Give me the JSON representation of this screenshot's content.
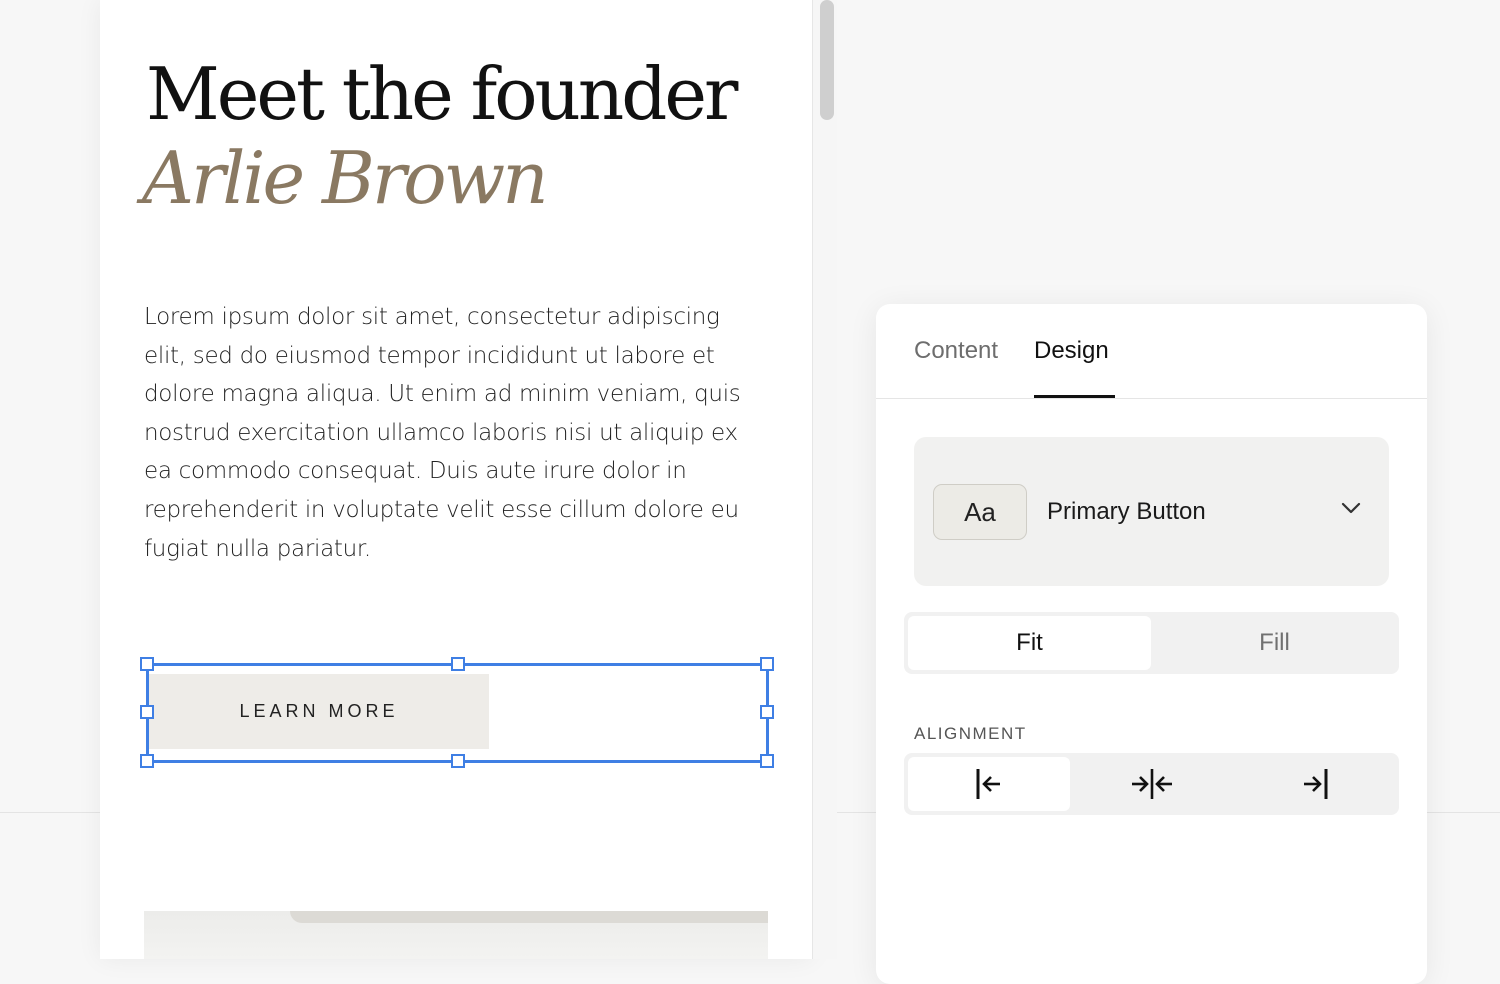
{
  "page": {
    "heading_line1": "Meet the founder",
    "heading_line2": "Arlie Brown",
    "body": "Lorem ipsum dolor sit amet, consectetur adipiscing elit, sed do eiusmod tempor incididunt ut labore et dolore magna aliqua. Ut enim ad minim veniam, quis nostrud exercitation ullamco laboris nisi ut aliquip ex ea commodo consequat. Duis aute irure dolor in reprehenderit in voluptate velit esse cillum dolore eu fugiat nulla pariatur.",
    "button_label": "LEARN MORE"
  },
  "panel": {
    "tabs": [
      {
        "label": "Content",
        "active": false
      },
      {
        "label": "Design",
        "active": true
      }
    ],
    "style_select": {
      "chip_label": "Aa",
      "value": "Primary Button",
      "icon": "chevron-down-icon"
    },
    "width_toggle": {
      "options": [
        "Fit",
        "Fill"
      ],
      "selected": "Fit"
    },
    "alignment": {
      "label": "ALIGNMENT",
      "options": [
        "align-left-icon",
        "align-center-icon",
        "align-right-icon"
      ],
      "selected": "align-left-icon"
    }
  },
  "colors": {
    "accent_selection": "#3f7fe4",
    "heading_accent": "#8a7962",
    "button_bg": "#eeece8"
  }
}
